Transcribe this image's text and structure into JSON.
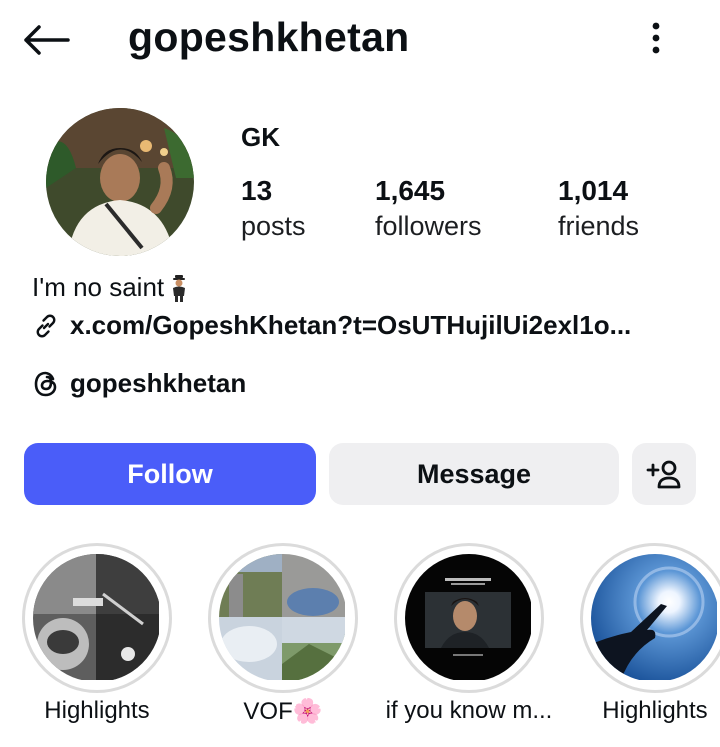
{
  "header": {
    "username": "gopeshkhetan"
  },
  "profile": {
    "display_name": "GK",
    "stats": [
      {
        "value": "13",
        "label": "posts"
      },
      {
        "value": "1,645",
        "label": "followers"
      },
      {
        "value": "1,014",
        "label": "friends"
      }
    ],
    "bio": "I'm no saint",
    "link": "x.com/GopeshKhetan?t=OsUTHujilUi2exl1o...",
    "threads_handle": "gopeshkhetan"
  },
  "actions": {
    "follow_label": "Follow",
    "message_label": "Message"
  },
  "highlights": [
    {
      "label": "Highlights"
    },
    {
      "label": "VOF🌸"
    },
    {
      "label": "if you know m..."
    },
    {
      "label": "Highlights"
    }
  ],
  "colors": {
    "follow_button": "#4a5df9",
    "secondary_button": "#efeff1",
    "text": "#0c1014"
  }
}
